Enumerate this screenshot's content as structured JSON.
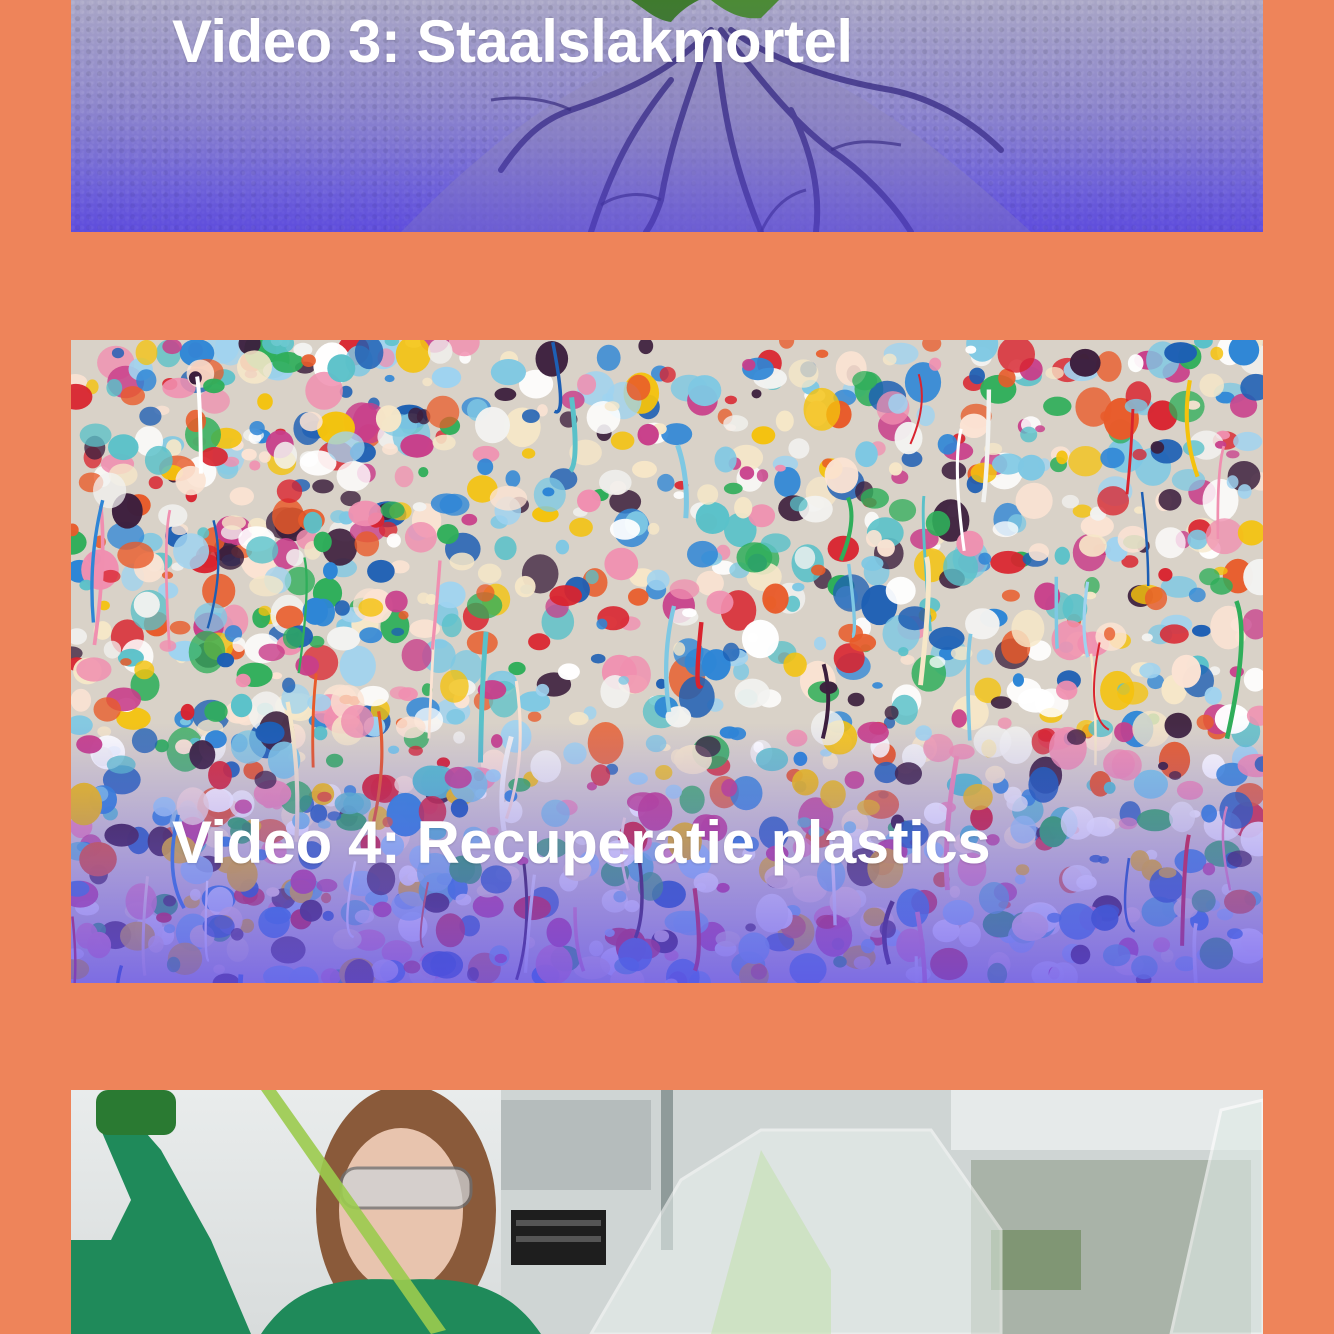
{
  "colors": {
    "page_background": "#EE845A",
    "title_text": "#FFFFFF",
    "overlay_tint": "#6250DC"
  },
  "videos": [
    {
      "title": "Video 3: Staalslakmortel",
      "thumbnail": "asphalt-crack-plant-image"
    },
    {
      "title": "Video 4: Recuperatie plastics",
      "thumbnail": "chewing-gum-wall-image"
    },
    {
      "title": "",
      "thumbnail": "lab-researcher-pipette-image"
    }
  ]
}
